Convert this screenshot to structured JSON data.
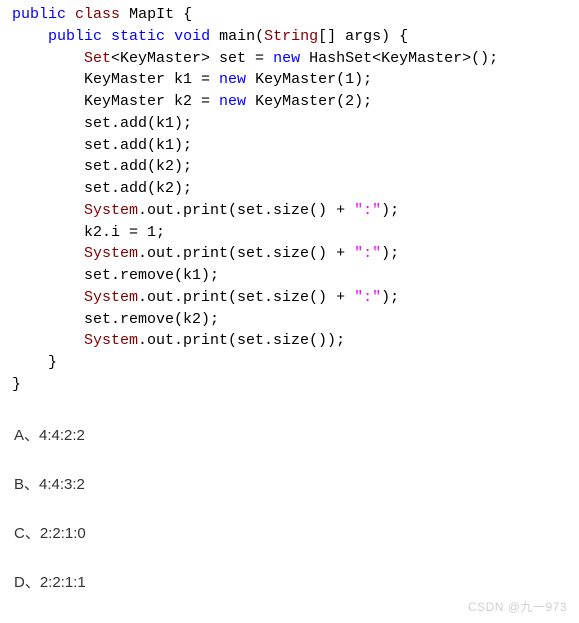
{
  "code": {
    "l1_kw1": "public",
    "l1_kw2": "class",
    "l1_cls": "MapIt {",
    "l2_kw1": "public",
    "l2_kw2": "static",
    "l2_kw3": "void",
    "l2_main": "main(",
    "l2_str": "String",
    "l2_args": "[] args) {",
    "l3_set": "Set",
    "l3_gen1": "<KeyMaster> set = ",
    "l3_new": "new",
    "l3_hash": " HashSet<KeyMaster>();",
    "l4_txt1": "KeyMaster k1 = ",
    "l4_new": "new",
    "l4_txt2": " KeyMaster(1);",
    "l5_txt1": "KeyMaster k2 = ",
    "l5_new": "new",
    "l5_txt2": " KeyMaster(2);",
    "l6": "set.add(k1);",
    "l7": "set.add(k1);",
    "l8": "set.add(k2);",
    "l9": "set.add(k2);",
    "l10_sys": "System",
    "l10_rest": ".out.print(set.size() + ",
    "l10_str": "\":\"",
    "l10_end": ");",
    "l11": "k2.i = 1;",
    "l12_sys": "System",
    "l12_rest": ".out.print(set.size() + ",
    "l12_str": "\":\"",
    "l12_end": ");",
    "l13": "set.remove(k1);",
    "l14_sys": "System",
    "l14_rest": ".out.print(set.size() + ",
    "l14_str": "\":\"",
    "l14_end": ");",
    "l15": "set.remove(k2);",
    "l16_sys": "System",
    "l16_rest": ".out.print(set.size());",
    "l17": "}",
    "l18": "}"
  },
  "answers": {
    "a": "A、4:4:2:2",
    "b": "B、4:4:3:2",
    "c": "C、2:2:1:0",
    "d": "D、2:2:1:1"
  },
  "watermark": "CSDN @九一973",
  "watermark2": ""
}
